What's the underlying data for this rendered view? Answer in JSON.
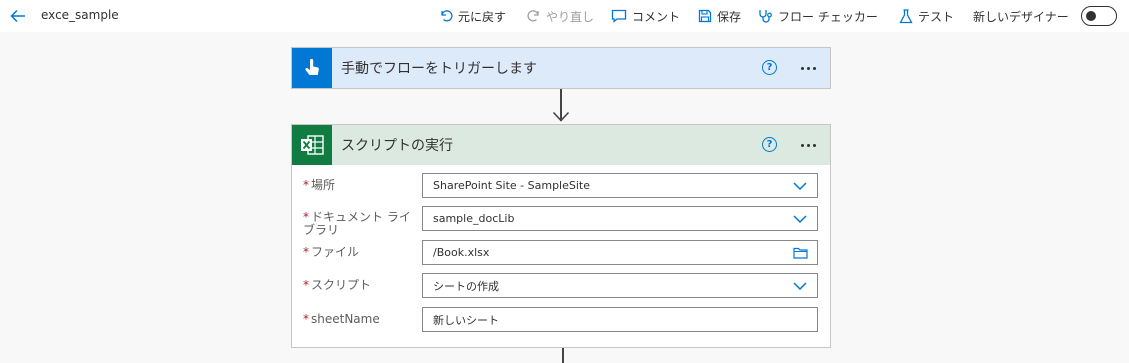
{
  "header": {
    "flow_name": "exce_sample",
    "undo_label": "元に戻す",
    "redo_label": "やり直し",
    "comment_label": "コメント",
    "save_label": "保存",
    "flow_checker_label": "フロー チェッカー",
    "test_label": "テスト",
    "new_designer_label": "新しいデザイナー",
    "new_designer_enabled": false
  },
  "trigger": {
    "title": "手動でフローをトリガーします",
    "icon": "hand-pointer-icon",
    "help": "?",
    "accent": "#0078d4",
    "header_bg": "#ddeafa"
  },
  "action": {
    "title": "スクリプトの実行",
    "icon": "excel-icon",
    "help": "?",
    "accent": "#107c41",
    "header_bg": "#dce9e1",
    "required_mark": "*",
    "fields": [
      {
        "label": "場所",
        "value": "SharePoint Site - SampleSite",
        "control": "dropdown"
      },
      {
        "label": "ドキュメント ライブラリ",
        "value": "sample_docLib",
        "control": "dropdown"
      },
      {
        "label": "ファイル",
        "value": "/Book.xlsx",
        "control": "file-picker"
      },
      {
        "label": "スクリプト",
        "value": "シートの作成",
        "control": "dropdown"
      },
      {
        "label": "sheetName",
        "value": "新しいシート",
        "control": "text"
      }
    ]
  }
}
